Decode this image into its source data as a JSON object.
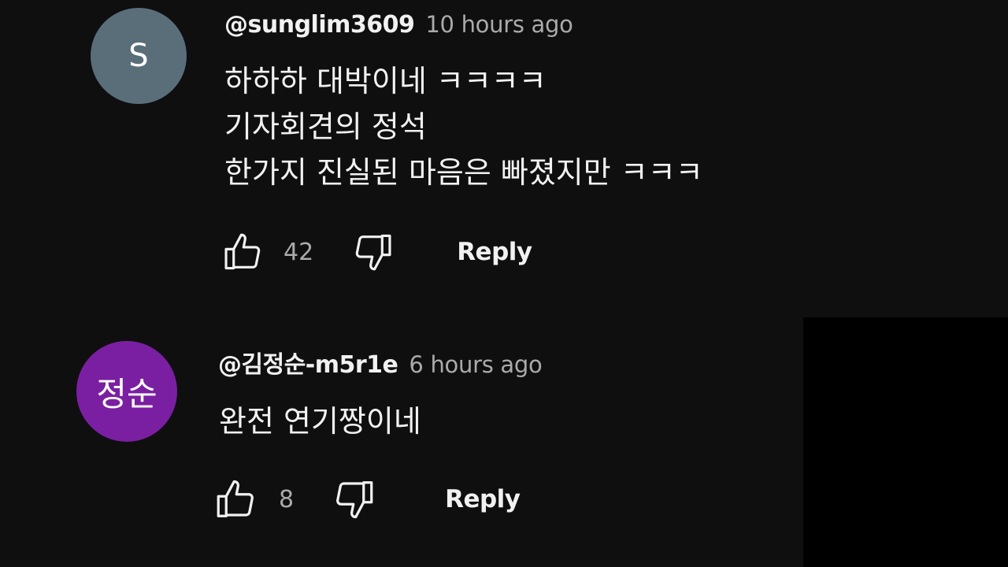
{
  "comments": [
    {
      "author": "@sunglim3609",
      "time": "10 hours ago",
      "avatar": {
        "initials": "S",
        "color": "#5a6e7a"
      },
      "lines": [
        "하하하 대박이네 ㅋㅋㅋㅋ",
        "기자회견의 정석",
        "한가지 진실된 마음은 빠졌지만 ㅋㅋㅋ"
      ],
      "likes": "42",
      "like_icon": "thumbs-up-icon",
      "dislike_icon": "thumbs-down-icon",
      "reply_label": "Reply"
    },
    {
      "author": "@김정순-m5r1e",
      "time": "6 hours ago",
      "avatar": {
        "initials": "정순",
        "color": "#7b1fa2"
      },
      "lines": [
        "완전 연기짱이네"
      ],
      "likes": "8",
      "like_icon": "thumbs-up-icon",
      "dislike_icon": "thumbs-down-icon",
      "reply_label": "Reply"
    }
  ]
}
